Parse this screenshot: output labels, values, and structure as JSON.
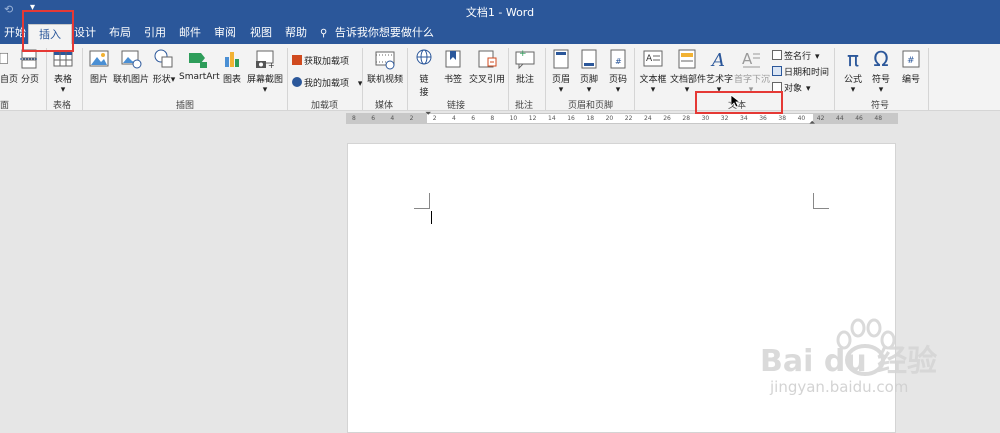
{
  "window": {
    "title": "文档1 - Word"
  },
  "tabs": [
    {
      "label": "开始",
      "active": false
    },
    {
      "label": "插入",
      "active": true
    },
    {
      "label": "设计",
      "active": false
    },
    {
      "label": "布局",
      "active": false
    },
    {
      "label": "引用",
      "active": false
    },
    {
      "label": "邮件",
      "active": false
    },
    {
      "label": "审阅",
      "active": false
    },
    {
      "label": "视图",
      "active": false
    },
    {
      "label": "帮助",
      "active": false
    }
  ],
  "tellme": {
    "placeholder": "告诉我你想要做什么"
  },
  "ribbon": {
    "groups": {
      "pages": "面",
      "tables": "表格",
      "illustrations": "插图",
      "addins": "加载项",
      "media": "媒体",
      "links": "链接",
      "comments": "批注",
      "header_footer": "页眉和页脚",
      "text": "文本",
      "symbols": "符号"
    },
    "buttons": {
      "page_break": "自页",
      "blank_page": "分页",
      "table": "表格",
      "picture": "图片",
      "online_picture": "联机图片",
      "shapes": "形状",
      "smartart": "SmartArt",
      "chart": "图表",
      "screenshot": "屏幕截图",
      "get_addins": "获取加载项",
      "my_addins": "我的加载项",
      "online_video": "联机视频",
      "link": "链",
      "link2": "接",
      "bookmark": "书签",
      "cross_ref": "交叉引用",
      "comment": "批注",
      "header": "页眉",
      "footer": "页脚",
      "page_number": "页码",
      "text_box": "文本框",
      "quick_parts": "文档部件",
      "wordart": "艺术字",
      "drop_cap": "首字下沉",
      "signature": "签名行",
      "date_time": "日期和时间",
      "object": "对象",
      "equation": "公式",
      "symbol": "符号",
      "number": "编号"
    }
  },
  "ruler": {
    "ticks": [
      "8",
      "6",
      "4",
      "2",
      "2",
      "4",
      "6",
      "8",
      "10",
      "12",
      "14",
      "16",
      "18",
      "20",
      "22",
      "24",
      "26",
      "28",
      "30",
      "32",
      "34",
      "36",
      "38",
      "40",
      "42",
      "44",
      "46",
      "48"
    ]
  },
  "watermark": {
    "brand": "Bai du 经验",
    "url": "jingyan.baidu.com"
  },
  "colors": {
    "accent": "#2b579a",
    "highlight": "#e53935"
  }
}
